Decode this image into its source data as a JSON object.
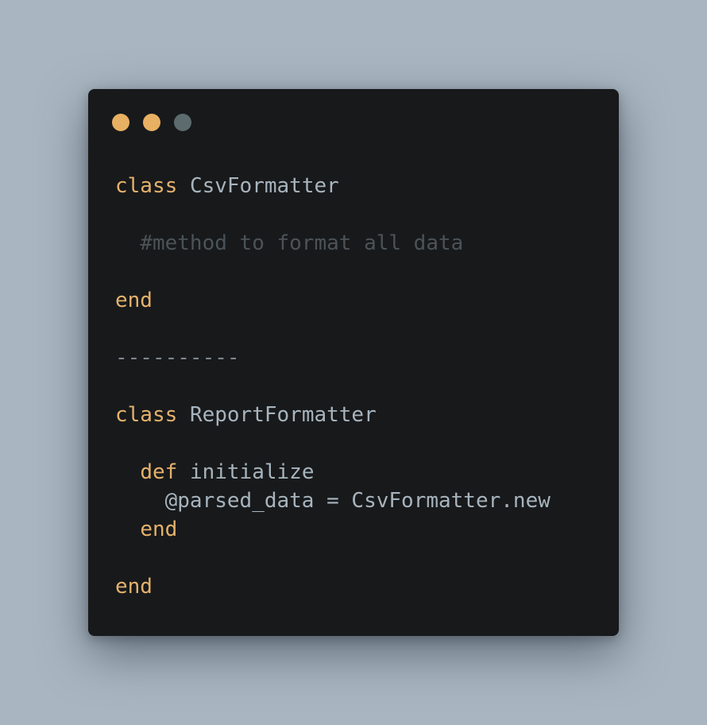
{
  "colors": {
    "background": "#a9b6c1",
    "window": "#18191b",
    "keyword": "#e4b26c",
    "identifier": "#a7b4bd",
    "comment": "#4b5358",
    "separator": "#7d8890",
    "dot_close": "#e8b062",
    "dot_minimize": "#e8b062",
    "dot_maximize": "#5c6b6e"
  },
  "window_controls": {
    "close_icon": "circle",
    "minimize_icon": "circle",
    "maximize_icon": "circle"
  },
  "code": {
    "line1": {
      "keyword": "class",
      "space": " ",
      "name": "CsvFormatter"
    },
    "line3": {
      "indent": "  ",
      "comment": "#method to format all data"
    },
    "line5": {
      "keyword": "end"
    },
    "line7": {
      "separator": "----------"
    },
    "line9": {
      "keyword": "class",
      "space": " ",
      "name": "ReportFormatter"
    },
    "line11": {
      "indent": "  ",
      "keyword": "def",
      "space": " ",
      "name": "initialize"
    },
    "line12": {
      "indent": "    ",
      "text": "@parsed_data = CsvFormatter.new"
    },
    "line13": {
      "indent": "  ",
      "keyword": "end"
    },
    "line15": {
      "keyword": "end"
    }
  }
}
